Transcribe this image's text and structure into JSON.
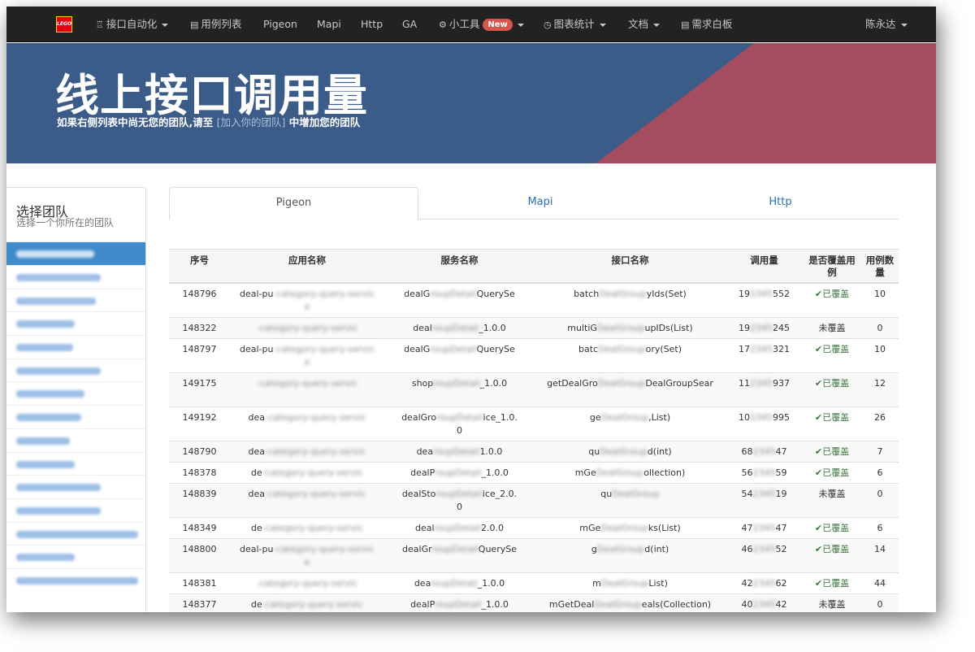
{
  "navbar": {
    "logo_text": "LEGO",
    "items": [
      {
        "icon": "robot-icon",
        "icon_glyph": "♖",
        "label": "接口自动化",
        "dropdown": true
      },
      {
        "icon": "list-icon",
        "icon_glyph": "▤",
        "label": "用例列表",
        "dropdown": false
      },
      {
        "icon": "",
        "icon_glyph": "",
        "label": "Pigeon",
        "dropdown": false
      },
      {
        "icon": "",
        "icon_glyph": "",
        "label": "Mapi",
        "dropdown": false
      },
      {
        "icon": "",
        "icon_glyph": "",
        "label": "Http",
        "dropdown": false
      },
      {
        "icon": "",
        "icon_glyph": "",
        "label": "GA",
        "dropdown": false
      },
      {
        "icon": "gear-icon",
        "icon_glyph": "⚙",
        "label": "小工具",
        "badge": "New",
        "dropdown": true
      },
      {
        "icon": "clock-icon",
        "icon_glyph": "◷",
        "label": "图表统计",
        "dropdown": true
      },
      {
        "icon": "",
        "icon_glyph": "",
        "label": "文档",
        "dropdown": true
      },
      {
        "icon": "board-icon",
        "icon_glyph": "▤",
        "label": "需求白板",
        "dropdown": false
      }
    ],
    "user": "陈永达"
  },
  "banner": {
    "title": "线上接口调用量",
    "subtitle_pre": "如果右侧列表中尚无您的团队,请至",
    "subtitle_link": "[加入你的团队]",
    "subtitle_post": "中增加您的团队",
    "colors": {
      "blue": "#3b5b88",
      "red": "#a34d5f"
    }
  },
  "sidebar": {
    "title": "选择团队",
    "subtitle": "选择一个你所在的团队"
  },
  "tabs": [
    {
      "label": "Pigeon",
      "active": true
    },
    {
      "label": "Mapi",
      "active": false
    },
    {
      "label": "Http",
      "active": false
    }
  ],
  "table": {
    "headers": {
      "id": "序号",
      "app": "应用名称",
      "service": "服务名称",
      "api": "接口名称",
      "calls": "调用量",
      "covered_l1": "是否覆盖用",
      "covered_l2": "例",
      "cases_l1": "用例数",
      "cases_l2": "量"
    },
    "rows": [
      {
        "id": "148796",
        "app_l1": "deal-pu",
        "app_l2": "e",
        "svc_l1": "dealG",
        "svc_l1b": "QuerySe",
        "svc_l2": "",
        "api_a": "batch",
        "api_b": "yIds(Set)",
        "api_l2": "",
        "calls_a": "19",
        "calls_b": "552",
        "covered": "已覆盖",
        "is_covered": true,
        "cases": "10"
      },
      {
        "id": "148322",
        "app_l1": "",
        "app_l2": "",
        "svc_l1": "deal",
        "svc_l1b": "_1.0.0",
        "svc_l2": "",
        "api_a": "multiG",
        "api_b": "upIDs(List)",
        "api_l2": "",
        "calls_a": "19",
        "calls_b": "245",
        "covered": "未覆盖",
        "is_covered": false,
        "cases": "0"
      },
      {
        "id": "148797",
        "app_l1": "deal-pu",
        "app_l2": "e",
        "svc_l1": "dealG",
        "svc_l1b": "QuerySe",
        "svc_l2": "",
        "api_a": "batc",
        "api_b": "ory(Set)",
        "api_l2": "",
        "calls_a": "17",
        "calls_b": "321",
        "covered": "已覆盖",
        "is_covered": true,
        "cases": "10"
      },
      {
        "id": "149175",
        "app_l1": "",
        "app_l2": "",
        "svc_l1": "shop",
        "svc_l1b": "_1.0.0",
        "svc_l2": "",
        "api_a": "getDealGro",
        "api_b": "DealGroupSear",
        "api_l2": "",
        "calls_a": "11",
        "calls_b": "937",
        "covered": "已覆盖",
        "is_covered": true,
        "cases": "12"
      },
      {
        "id": "149192",
        "app_l1": "dea",
        "app_l2": "",
        "svc_l1": "dealGro",
        "svc_l1b": "ice_1.0.",
        "svc_l2": "0",
        "api_a": "ge",
        "api_b": ",List)",
        "api_l2": "",
        "calls_a": "10",
        "calls_b": "995",
        "covered": "已覆盖",
        "is_covered": true,
        "cases": "26"
      },
      {
        "id": "148790",
        "app_l1": "dea",
        "app_l2": "",
        "svc_l1": "dea",
        "svc_l1b": "1.0.0",
        "svc_l2": "",
        "api_a": "qu",
        "api_b": "d(int)",
        "api_l2": "",
        "calls_a": "68",
        "calls_b": "47",
        "covered": "已覆盖",
        "is_covered": true,
        "cases": "7"
      },
      {
        "id": "148378",
        "app_l1": "de",
        "app_l2": "",
        "svc_l1": "dealP",
        "svc_l1b": "_1.0.0",
        "svc_l2": "",
        "api_a": "mGe",
        "api_b": "ollection)",
        "api_l2": "",
        "calls_a": "56",
        "calls_b": "59",
        "covered": "已覆盖",
        "is_covered": true,
        "cases": "6"
      },
      {
        "id": "148839",
        "app_l1": "dea",
        "app_l2": "",
        "svc_l1": "dealSto",
        "svc_l1b": "ice_2.0.",
        "svc_l2": "0",
        "api_a": "qu",
        "api_b": "",
        "api_l2": "",
        "calls_a": "54",
        "calls_b": "19",
        "covered": "未覆盖",
        "is_covered": false,
        "cases": "0"
      },
      {
        "id": "148349",
        "app_l1": "de",
        "app_l2": "",
        "svc_l1": "deal",
        "svc_l1b": "2.0.0",
        "svc_l2": "",
        "api_a": "mGe",
        "api_b": "ks(List)",
        "api_l2": "",
        "calls_a": "47",
        "calls_b": "47",
        "covered": "已覆盖",
        "is_covered": true,
        "cases": "6"
      },
      {
        "id": "148800",
        "app_l1": "deal-pu",
        "app_l2": "e",
        "svc_l1": "dealGr",
        "svc_l1b": "QuerySe",
        "svc_l2": "",
        "api_a": "g",
        "api_b": "d(int)",
        "api_l2": "",
        "calls_a": "46",
        "calls_b": "52",
        "covered": "已覆盖",
        "is_covered": true,
        "cases": "14"
      },
      {
        "id": "148381",
        "app_l1": "",
        "app_l2": "",
        "svc_l1": "dea",
        "svc_l1b": "_1.0.0",
        "svc_l2": "",
        "api_a": "m",
        "api_b": "List)",
        "api_l2": "",
        "calls_a": "42",
        "calls_b": "62",
        "covered": "已覆盖",
        "is_covered": true,
        "cases": "44"
      },
      {
        "id": "148377",
        "app_l1": "de",
        "app_l2": "",
        "svc_l1": "dealP",
        "svc_l1b": "_1.0.0",
        "svc_l2": "",
        "api_a": "mGetDeal",
        "api_b": "eals(Collection)",
        "api_l2": "",
        "calls_a": "40",
        "calls_b": "42",
        "covered": "未覆盖",
        "is_covered": false,
        "cases": "0"
      }
    ]
  }
}
